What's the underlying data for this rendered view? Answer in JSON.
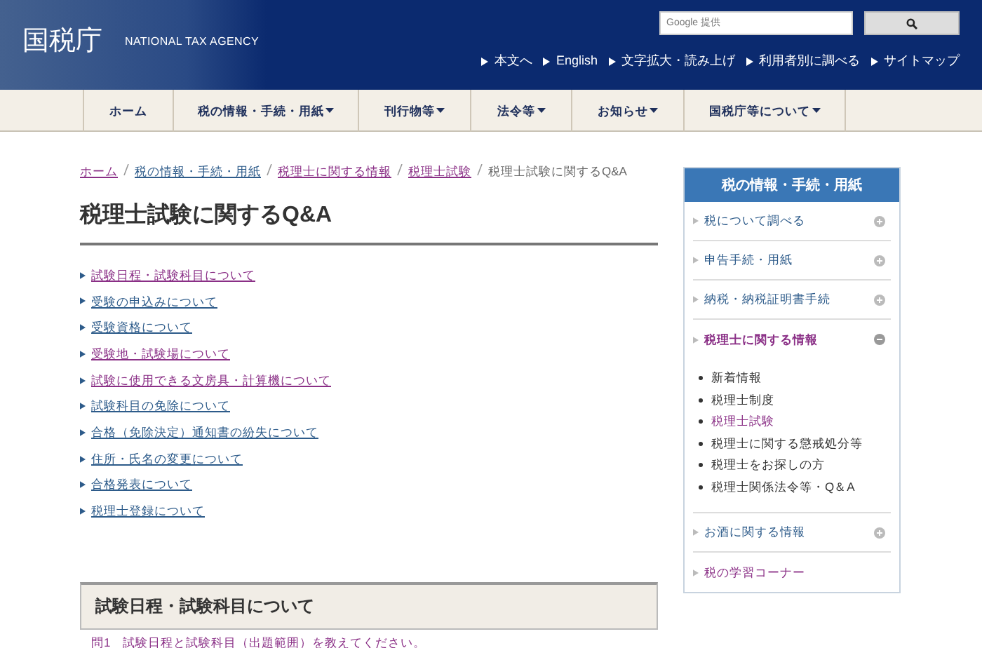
{
  "header": {
    "logo": "国税庁",
    "logo_sub": "NATIONAL TAX AGENCY",
    "search": {
      "placeholder": "Google 提供"
    },
    "utility_links": [
      "本文へ",
      "English",
      "文字拡大・読み上げ",
      "利用者別に調べる",
      "サイトマップ"
    ]
  },
  "nav": [
    {
      "label": "ホーム",
      "dropdown": false
    },
    {
      "label": "税の情報・手続・用紙",
      "dropdown": true
    },
    {
      "label": "刊行物等",
      "dropdown": true
    },
    {
      "label": "法令等",
      "dropdown": true
    },
    {
      "label": "お知らせ",
      "dropdown": true
    },
    {
      "label": "国税庁等について",
      "dropdown": true
    }
  ],
  "breadcrumb": [
    {
      "label": "ホーム",
      "visited": true
    },
    {
      "label": "税の情報・手続・用紙",
      "visited": false
    },
    {
      "label": "税理士に関する情報",
      "visited": true
    },
    {
      "label": "税理士試験",
      "visited": true
    },
    {
      "label": "税理士試験に関するQ&A",
      "current": true
    }
  ],
  "title": "税理士試験に関するQ&A",
  "toc": [
    {
      "label": "試験日程・試験科目について",
      "visited": true
    },
    {
      "label": "受験の申込みについて",
      "visited": false
    },
    {
      "label": "受験資格について",
      "visited": false
    },
    {
      "label": "受験地・試験場について",
      "visited": true
    },
    {
      "label": "試験に使用できる文房具・計算機について",
      "visited": true
    },
    {
      "label": "試験科目の免除について",
      "visited": false
    },
    {
      "label": "合格（免除決定）通知書の紛失について",
      "visited": false
    },
    {
      "label": "住所・氏名の変更について",
      "visited": false
    },
    {
      "label": "合格発表について",
      "visited": false
    },
    {
      "label": "税理士登録について",
      "visited": false
    }
  ],
  "section": {
    "heading": "試験日程・試験科目について",
    "question": "問1　試験日程と試験科目（出題範囲）を教えてください。"
  },
  "sidebar": {
    "title": "税の情報・手続・用紙",
    "items": [
      {
        "label": "税について調べる",
        "kind": "toggle",
        "visited": false,
        "expanded": false
      },
      {
        "label": "申告手続・用紙",
        "kind": "toggle",
        "visited": false,
        "expanded": false
      },
      {
        "label": "納税・納税証明書手続",
        "kind": "toggle",
        "visited": false,
        "expanded": false
      },
      {
        "label": "税理士に関する情報",
        "kind": "toggle",
        "visited": true,
        "expanded": true,
        "children": [
          {
            "label": "新着情報",
            "visited": false
          },
          {
            "label": "税理士制度",
            "visited": false
          },
          {
            "label": "税理士試験",
            "visited": true
          },
          {
            "label": "税理士に関する懲戒処分等",
            "visited": false
          },
          {
            "label": "税理士をお探しの方",
            "visited": false
          },
          {
            "label": "税理士関係法令等・Q＆A",
            "visited": false
          }
        ]
      },
      {
        "label": "お酒に関する情報",
        "kind": "toggle",
        "visited": false,
        "expanded": false
      },
      {
        "label": "税の学習コーナー",
        "kind": "link",
        "visited": true
      }
    ]
  }
}
